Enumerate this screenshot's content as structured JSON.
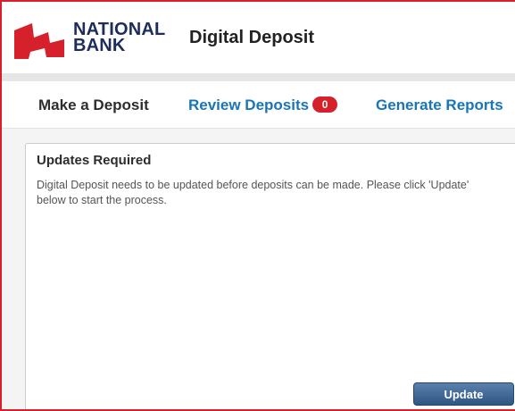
{
  "header": {
    "brand_line1": "NATIONAL",
    "brand_line2": "BANK",
    "app_title": "Digital Deposit",
    "logo_icon": "national-bank-flag-logo"
  },
  "tabs": [
    {
      "label": "Make a Deposit",
      "active": true
    },
    {
      "label": "Review Deposits",
      "badge": "0"
    },
    {
      "label": "Generate Reports"
    }
  ],
  "panel": {
    "title": "Updates Required",
    "message": "Digital Deposit needs to be updated before deposits can be made. Please click 'Update' below to start the process.",
    "button_label": "Update"
  },
  "colors": {
    "brand_red": "#d6202b",
    "brand_navy": "#1d2d5c",
    "link_blue": "#1a75b7",
    "button_blue": "#3d6593"
  }
}
